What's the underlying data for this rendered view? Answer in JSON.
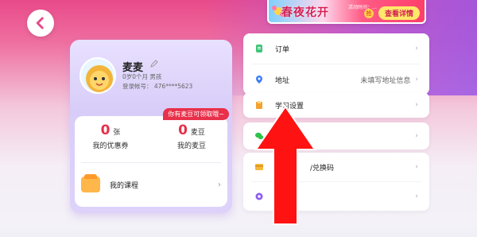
{
  "colors": {
    "accent": "#e8304a",
    "brand": "#e84a8a",
    "purple": "#9a57e6"
  },
  "nav": {
    "back_icon": "back-arrow-icon"
  },
  "banner": {
    "title": "春夜花开",
    "small_text": "活动时间：…",
    "coin": "抢",
    "button": "查看详情"
  },
  "profile": {
    "name": "麦麦",
    "age_gender": "0岁0个月  男孩",
    "account": "登录帐号：  476****5623",
    "promo_badge": "你有麦豆可领取哦~",
    "stats": [
      {
        "value": "0",
        "unit": "张",
        "label": "我的优惠券"
      },
      {
        "value": "0",
        "unit": "麦豆",
        "label": "我的麦豆"
      }
    ],
    "course_label": "我的课程"
  },
  "menu": {
    "group1": [
      {
        "icon": "order-icon",
        "label": "订单",
        "value": ""
      },
      {
        "icon": "location-icon",
        "label": "地址",
        "value": "未填写地址信息"
      }
    ],
    "group2": [
      {
        "icon": "study-settings-icon",
        "label": "学习设置",
        "value": ""
      }
    ],
    "group3": [
      {
        "icon": "wechat-icon",
        "label": "",
        "value": ""
      }
    ],
    "group4": [
      {
        "icon": "card-icon",
        "label": "/兑换码",
        "value": ""
      },
      {
        "icon": "settings-gear-icon",
        "label": "设置",
        "value": ""
      }
    ],
    "chevron": "›"
  }
}
